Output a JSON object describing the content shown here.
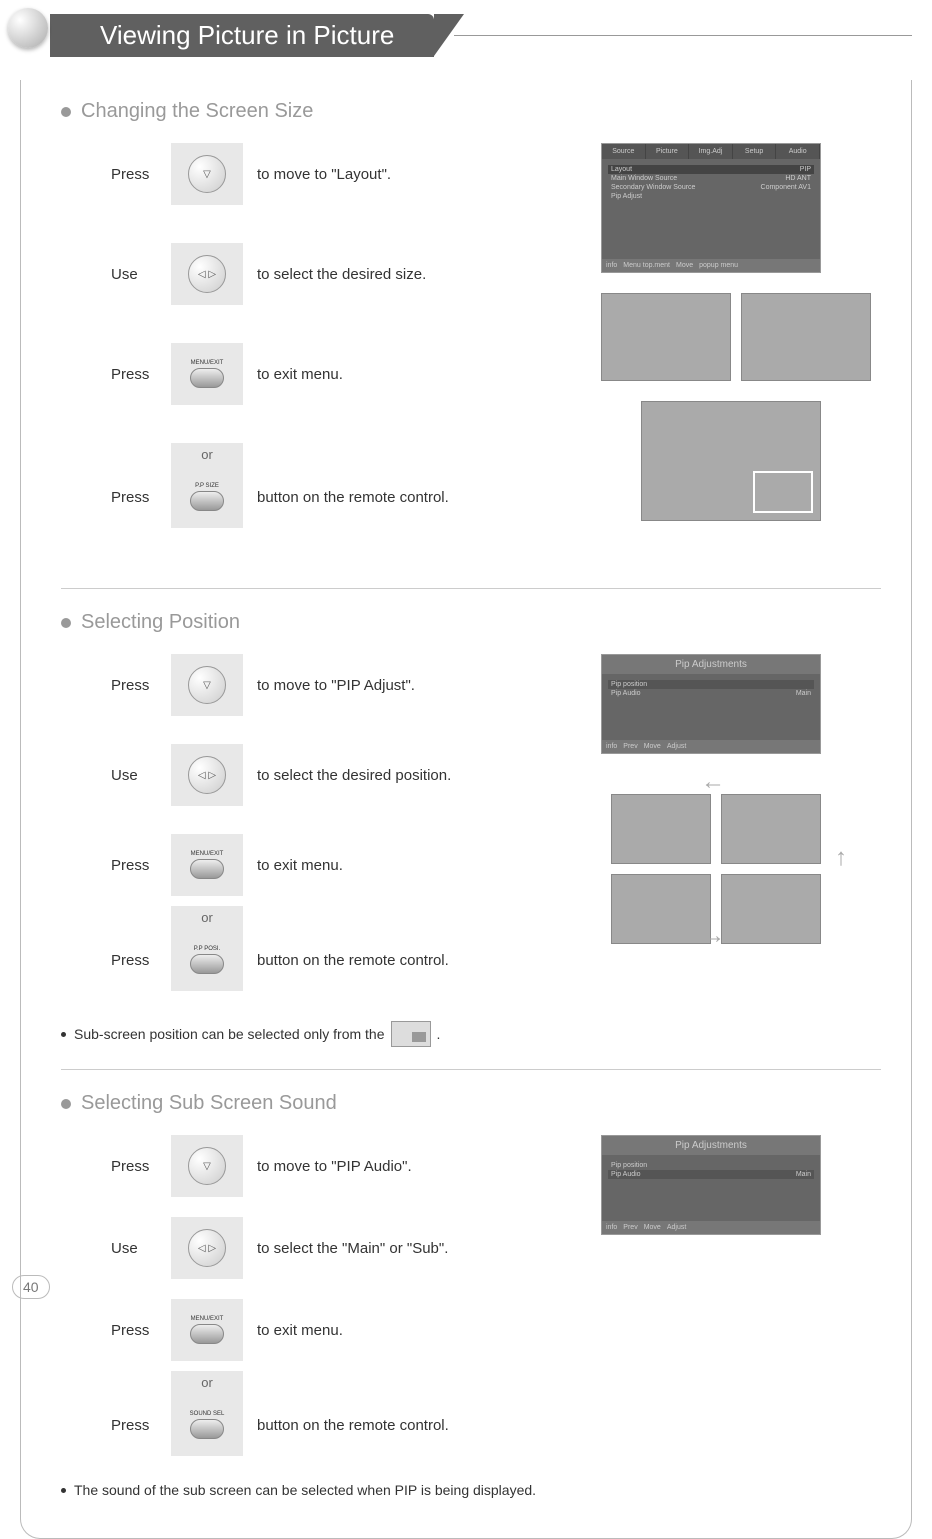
{
  "page": {
    "title": "Viewing Picture in Picture",
    "number": "40"
  },
  "section1": {
    "title": "Changing the Screen Size",
    "steps": [
      {
        "left": "Press",
        "right": "to move to \"Layout\"."
      },
      {
        "left": "Use",
        "right": "to select the desired size."
      },
      {
        "left": "Press",
        "right": "to exit menu."
      },
      {
        "left": "Press",
        "right": "button on the remote control."
      }
    ],
    "or": "or",
    "remote_button_label": "P.P SIZE",
    "exit_button_label": "MENU/EXIT"
  },
  "menu_screenshot": {
    "tabs": [
      "Source",
      "Picture",
      "Img.Adj",
      "Setup",
      "Audio"
    ],
    "rows": [
      {
        "label": "Layout",
        "value": "PIP"
      },
      {
        "label": "Main Window Source",
        "value": "HD ANT"
      },
      {
        "label": "Secondary Window Source",
        "value": "Component AV1"
      },
      {
        "label": "Pip Adjust",
        "value": ""
      }
    ],
    "footer": [
      "info",
      "Menu top.ment",
      "Move",
      "popup menu"
    ]
  },
  "section2": {
    "title": "Selecting Position",
    "steps": [
      {
        "left": "Press",
        "right": "to move to \"PIP Adjust\"."
      },
      {
        "left": "Use",
        "right": "to select the desired position."
      },
      {
        "left": "Press",
        "right": "to exit menu."
      },
      {
        "left": "Press",
        "right": "button on the remote control."
      }
    ],
    "or": "or",
    "remote_button_label": "P.P POSI.",
    "note": "Sub-screen position can be selected only from the",
    "note_end": "."
  },
  "pip_adjust_screenshot": {
    "title": "Pip Adjustments",
    "rows": [
      {
        "label": "Pip position",
        "value": ""
      },
      {
        "label": "Pip Audio",
        "value": "Main"
      }
    ],
    "footer": [
      "info",
      "Prev",
      "Move",
      "Adjust"
    ]
  },
  "section3": {
    "title": "Selecting Sub Screen Sound",
    "steps": [
      {
        "left": "Press",
        "right": "to move to \"PIP Audio\"."
      },
      {
        "left": "Use",
        "right": "to select the \"Main\" or \"Sub\"."
      },
      {
        "left": "Press",
        "right": "to exit menu."
      },
      {
        "left": "Press",
        "right": "button on the remote control."
      }
    ],
    "or": "or",
    "remote_button_label": "SOUND SEL",
    "note": "The sound of the sub screen can be selected  when PIP is being displayed."
  },
  "pip_audio_screenshot": {
    "title": "Pip Adjustments",
    "rows": [
      {
        "label": "Pip position",
        "value": ""
      },
      {
        "label": "Pip Audio",
        "value": "Main"
      }
    ],
    "footer": [
      "info",
      "Prev",
      "Move",
      "Adjust"
    ]
  }
}
